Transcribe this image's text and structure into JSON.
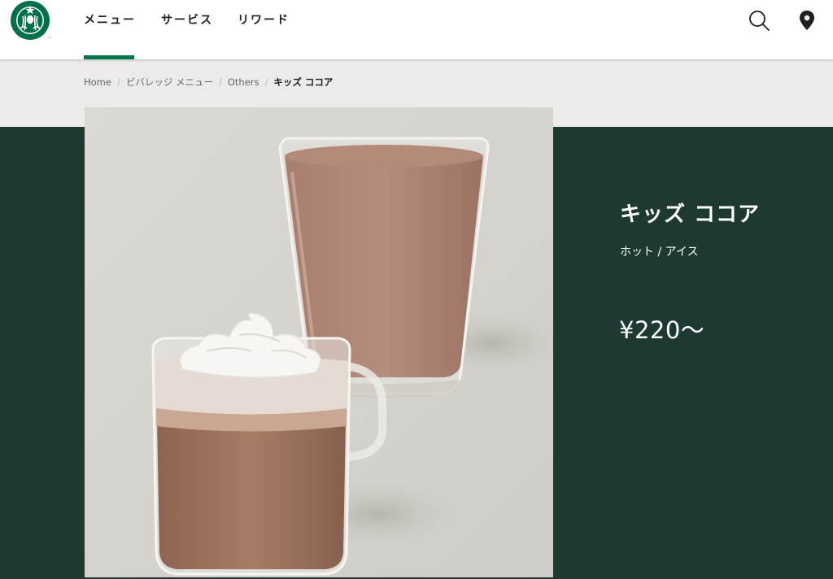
{
  "header": {
    "logo_alt": "Starbucks",
    "nav": [
      {
        "label": "メニュー",
        "active": true
      },
      {
        "label": "サービス",
        "active": false
      },
      {
        "label": "リワード",
        "active": false
      }
    ],
    "icons": [
      "search-icon",
      "location-pin-icon"
    ]
  },
  "breadcrumb": {
    "items": [
      "Home",
      "ビバレッジ メニュー",
      "Others"
    ],
    "current": "キッズ ココア",
    "separator": "/"
  },
  "product": {
    "name": "キッズ ココア",
    "variant": "ホット / アイス",
    "price": "¥220〜",
    "image_alt": "キッズ ココア"
  },
  "colors": {
    "brand_green": "#00754a",
    "house_green": "#1e3932",
    "warm_neutral": "#ecebe9"
  }
}
